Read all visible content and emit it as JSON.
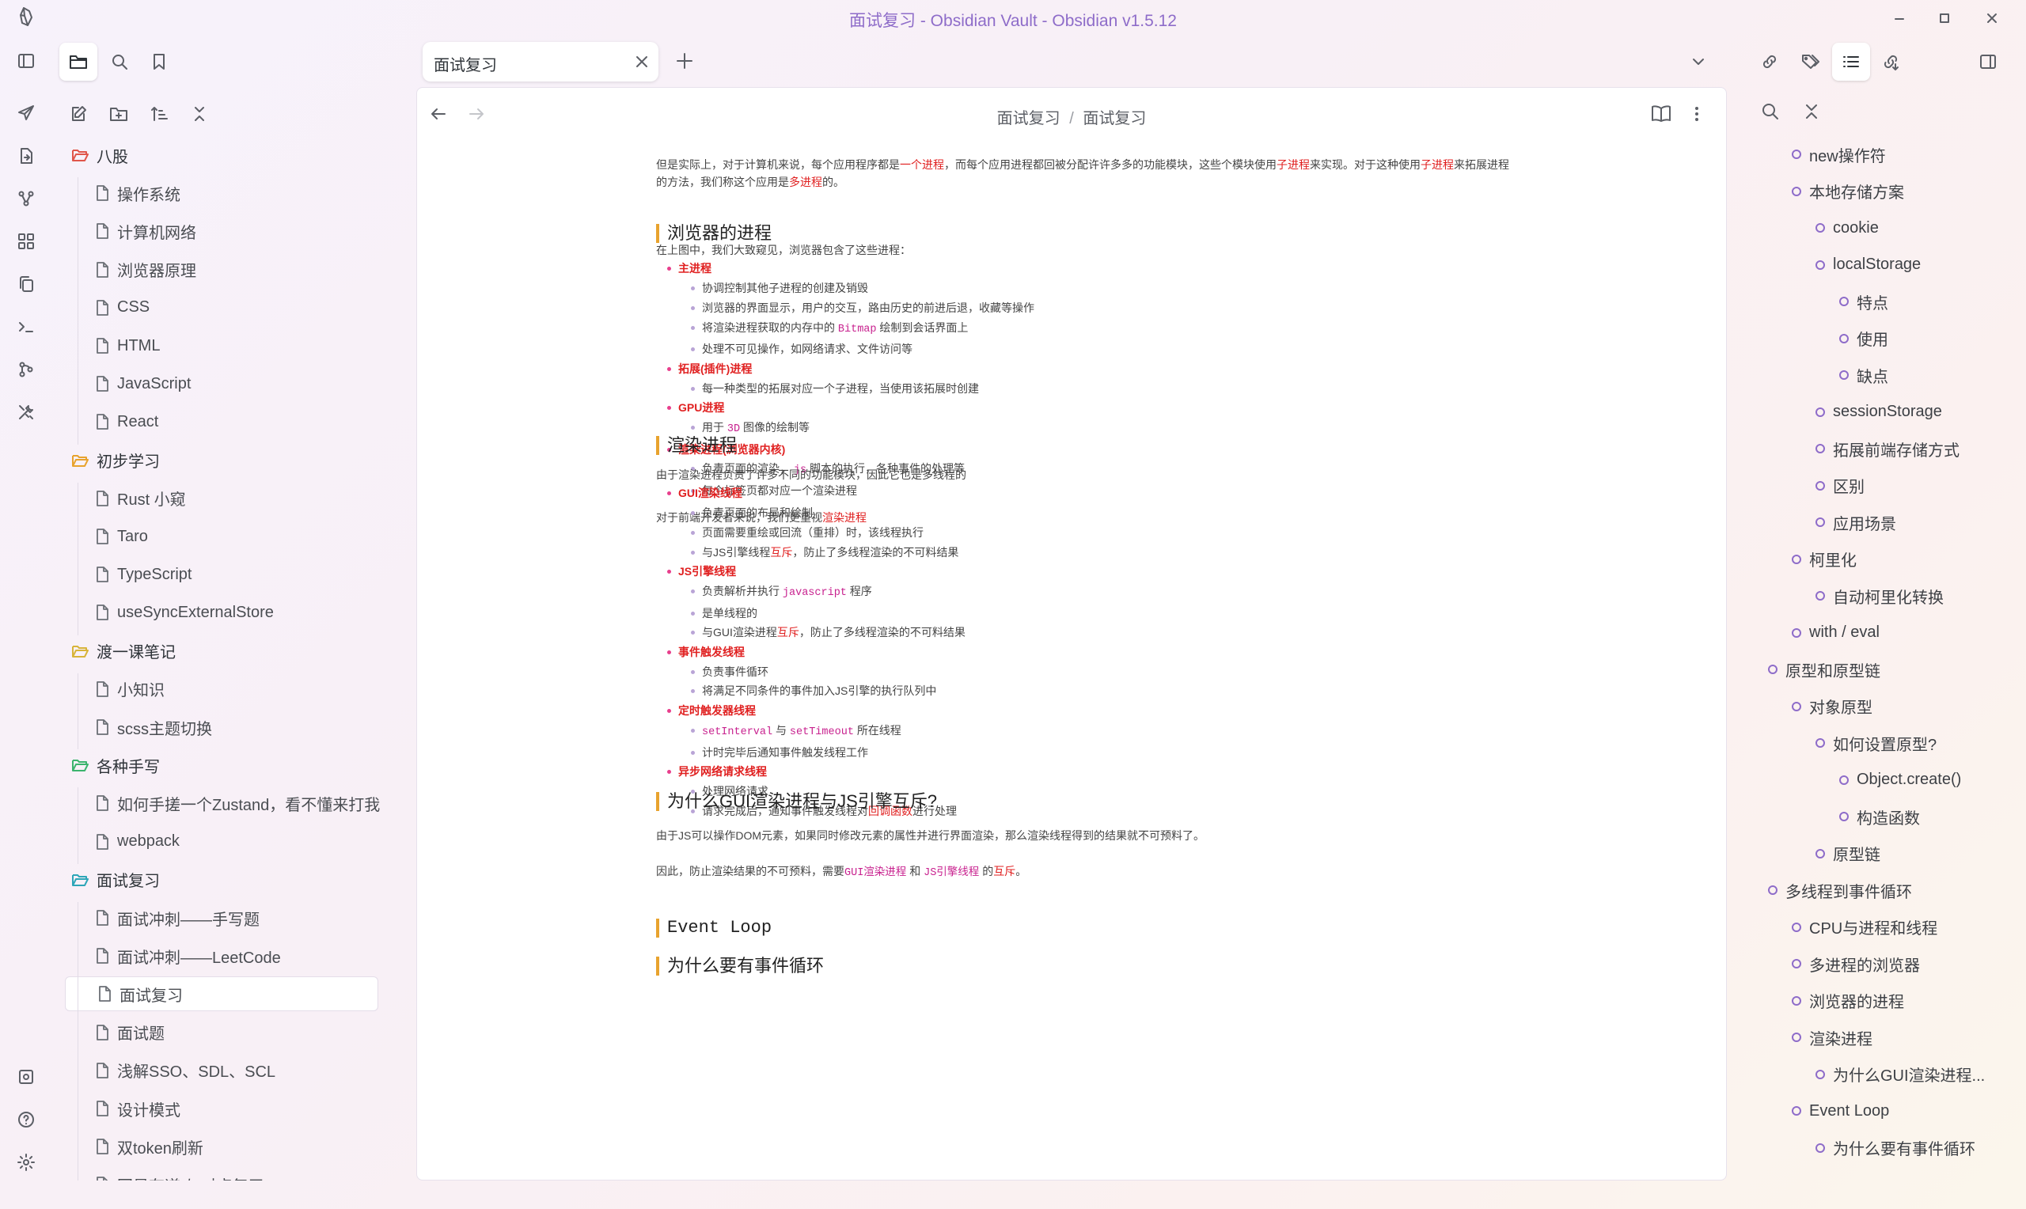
{
  "app_title": "面试复习 - Obsidian Vault - Obsidian v1.5.12",
  "colors": {
    "accent": "#8e6cc9",
    "red_text": "#e02020",
    "code_pink": "#c8228f",
    "heading_bar": "#e8a32e"
  },
  "ribbon_icons": [
    "sidebar-toggle-icon",
    "send-icon",
    "file-export-icon",
    "graph-icon",
    "canvas-icon",
    "copy-icon",
    "terminal-icon",
    "git-icon",
    "tools-icon",
    "vault-icon",
    "help-icon",
    "settings-icon"
  ],
  "tab": {
    "title": "面试复习"
  },
  "breadcrumb": {
    "parent": "面试复习",
    "sep": "/",
    "current": "面试复习"
  },
  "tree": [
    {
      "type": "folder",
      "label": "八股",
      "color": "#e0564a"
    },
    {
      "type": "file",
      "label": "操作系统"
    },
    {
      "type": "file",
      "label": "计算机网络"
    },
    {
      "type": "file",
      "label": "浏览器原理"
    },
    {
      "type": "file",
      "label": "CSS"
    },
    {
      "type": "file",
      "label": "HTML"
    },
    {
      "type": "file",
      "label": "JavaScript"
    },
    {
      "type": "file",
      "label": "React"
    },
    {
      "type": "folder",
      "label": "初步学习",
      "color": "#e8a32e"
    },
    {
      "type": "file",
      "label": "Rust 小窥"
    },
    {
      "type": "file",
      "label": "Taro"
    },
    {
      "type": "file",
      "label": "TypeScript"
    },
    {
      "type": "file",
      "label": "useSyncExternalStore"
    },
    {
      "type": "folder",
      "label": "渡一课笔记",
      "color": "#d8b43a"
    },
    {
      "type": "file",
      "label": "小知识"
    },
    {
      "type": "file",
      "label": "scss主题切换"
    },
    {
      "type": "folder",
      "label": "各种手写",
      "color": "#3cb46e"
    },
    {
      "type": "file",
      "label": "如何手搓一个Zustand，看不懂来打我"
    },
    {
      "type": "file",
      "label": "webpack"
    },
    {
      "type": "folder",
      "label": "面试复习",
      "color": "#2ea6b8"
    },
    {
      "type": "file",
      "label": "面试冲刺——手写题"
    },
    {
      "type": "file",
      "label": "面试冲刺——LeetCode"
    },
    {
      "type": "file",
      "label": "面试复习",
      "selected": true
    },
    {
      "type": "file",
      "label": "面试题"
    },
    {
      "type": "file",
      "label": "浅解SSO、SDL、SCL"
    },
    {
      "type": "file",
      "label": "设计模式"
    },
    {
      "type": "file",
      "label": "双token刷新"
    },
    {
      "type": "file",
      "label": "回显有道 与对点复习"
    }
  ],
  "doc": {
    "intro": {
      "a": "但是实际上，对于计算机来说，每个应用程序都是",
      "b": "一个进程",
      "c": "，而每个应用进程都回被分配许许多多的功能模块，这些个模块使用",
      "d": "子进程",
      "e": "来实现。对于这种使用",
      "f": "子进程",
      "g": "来拓展进程的方法，我们称这个应用是",
      "h": "多进程",
      "i": "的。"
    },
    "h_browser_proc": "浏览器的进程",
    "p_browser_proc": "在上图中，我们大致窥见，浏览器包含了这些进程：",
    "main_proc": {
      "label": "主进程",
      "items": [
        "协调控制其他子进程的创建及销毁",
        "浏览器的界面显示，用户的交互，路由历史的前进后退，收藏等操作"
      ],
      "bitmap_a": "将渲染进程获取的内存中的",
      "bitmap_code": "Bitmap",
      "bitmap_b": "绘制到会话界面上",
      "last": "处理不可见操作，如网络请求、文件访问等"
    },
    "ext_proc": {
      "label": "拓展(插件)进程",
      "items": [
        "每一种类型的拓展对应一个子进程，当使用该拓展时创建"
      ]
    },
    "gpu_proc": {
      "label": "GPU进程",
      "a": "用于",
      "code": "3D",
      "b": "图像的绘制等"
    },
    "render_proc": {
      "label": "渲染进程(浏览器内核)",
      "a": "负责页面的渲染，",
      "code": "js",
      "b": "脚本的执行，各种事件的处理等",
      "last": "每个标签页都对应一个渲染进程"
    },
    "p_frontend_a": "对于前端开发者来说，我们更重视",
    "p_frontend_b": "渲染进程",
    "h_render": "渲染进程",
    "p_render": "由于渲染进程负责了许多不同的功能模块，因此它也是多线程的",
    "gui_thread": {
      "label": "GUI渲染线程",
      "i1": "负责页面的布局和绘制",
      "i2": "页面需要重绘或回流（重排）时，该线程执行",
      "i3a": "与JS引擎线程",
      "i3b": "互斥",
      "i3c": "，防止了多线程渲染的不可料结果"
    },
    "js_thread": {
      "label": "JS引擎线程",
      "i1a": "负责解析并执行",
      "i1code": "javascript",
      "i1b": "程序",
      "i2": "是单线程的",
      "i3a": "与GUI渲染进程",
      "i3b": "互斥",
      "i3c": "，防止了多线程渲染的不可料结果"
    },
    "event_thread": {
      "label": "事件触发线程",
      "i1": "负责事件循环",
      "i2": "将满足不同条件的事件加入JS引擎的执行队列中"
    },
    "timer_thread": {
      "label": "定时触发器线程",
      "code1": "setInterval",
      "mid": "与",
      "code2": "setTimeout",
      "tail": "所在线程",
      "i2": "计时完毕后通知事件触发线程工作"
    },
    "net_thread": {
      "label": "异步网络请求线程",
      "i1": "处理网络请求",
      "i2a": "请求完成后，通知事件触发线程对",
      "i2b": "回调函数",
      "i2c": "进行处理"
    },
    "h_why_mutex": "为什么GUI渲染进程与JS引擎互斥?",
    "p_why_mutex": "由于JS可以操作DOM元素，如果同时修改元素的属性并进行界面渲染，那么渲染线程得到的结果就不可预料了。",
    "p_therefore": {
      "a": "因此，防止渲染结果的不可预料，需要",
      "c1": "GUI渲染进程",
      "b": "和",
      "c2": "JS引擎线程",
      "c": "的",
      "d": "互斥",
      "e": "。"
    },
    "h_event_loop": "Event Loop",
    "h_why_loop": "为什么要有事件循环"
  },
  "outline": [
    {
      "label": "new操作符",
      "level": 2
    },
    {
      "label": "本地存储方案",
      "level": 2
    },
    {
      "label": "cookie",
      "level": 3
    },
    {
      "label": "localStorage",
      "level": 3
    },
    {
      "label": "特点",
      "level": 4
    },
    {
      "label": "使用",
      "level": 4
    },
    {
      "label": "缺点",
      "level": 4
    },
    {
      "label": "sessionStorage",
      "level": 3
    },
    {
      "label": "拓展前端存储方式",
      "level": 3
    },
    {
      "label": "区别",
      "level": 3
    },
    {
      "label": "应用场景",
      "level": 3
    },
    {
      "label": "柯里化",
      "level": 2
    },
    {
      "label": "自动柯里化转换",
      "level": 3
    },
    {
      "label": "with / eval",
      "level": 2
    },
    {
      "label": "原型和原型链",
      "level": 1
    },
    {
      "label": "对象原型",
      "level": 2
    },
    {
      "label": "如何设置原型?",
      "level": 3
    },
    {
      "label": "Object.create()",
      "level": 4
    },
    {
      "label": "构造函数",
      "level": 4
    },
    {
      "label": "原型链",
      "level": 3
    },
    {
      "label": "多线程到事件循环",
      "level": 1
    },
    {
      "label": "CPU与进程和线程",
      "level": 2
    },
    {
      "label": "多进程的浏览器",
      "level": 2
    },
    {
      "label": "浏览器的进程",
      "level": 2
    },
    {
      "label": "渲染进程",
      "level": 2
    },
    {
      "label": "为什么GUI渲染进程...",
      "level": 3
    },
    {
      "label": "Event Loop",
      "level": 2
    },
    {
      "label": "为什么要有事件循环",
      "level": 3
    }
  ]
}
